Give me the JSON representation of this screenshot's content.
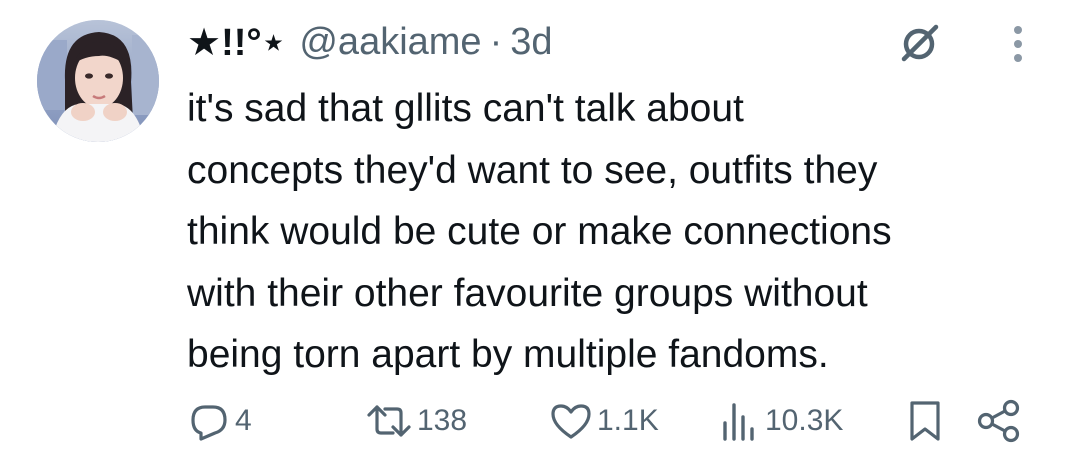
{
  "author": {
    "display_name": "★!!°⋆",
    "handle": "@aakiame",
    "separator": "·",
    "time": "3d"
  },
  "icons": {
    "avatar": "profile-photo",
    "grok": "grok-icon",
    "more": "more-vertical-icon",
    "reply": "reply-icon",
    "retweet": "retweet-icon",
    "like": "heart-icon",
    "views": "analytics-icon",
    "bookmark": "bookmark-icon",
    "share": "share-icon"
  },
  "tweet": {
    "text": "it's sad that gllits can't talk about\nconcepts they'd want to see, outfits they\nthink would be cute or make connections\nwith their other favourite groups without\nbeing torn apart by multiple fandoms."
  },
  "stats": {
    "replies": "4",
    "retweets": "138",
    "likes": "1.1K",
    "views": "10.3K"
  },
  "colors": {
    "text_primary": "#0f1419",
    "text_secondary": "#536471",
    "background": "#ffffff"
  }
}
